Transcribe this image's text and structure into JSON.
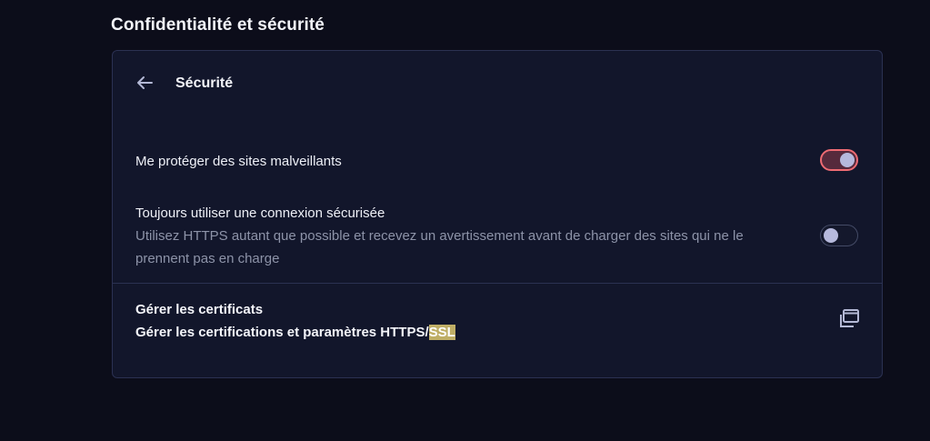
{
  "page": {
    "section_title": "Confidentialité et sécurité"
  },
  "card": {
    "header_title": "Sécurité",
    "back_icon": "arrow-left-icon"
  },
  "settings": [
    {
      "label": "Me protéger des sites malveillants",
      "description": "",
      "enabled": true
    },
    {
      "label": "Toujours utiliser une connexion sécurisée",
      "description": "Utilisez HTTPS autant que possible et recevez un avertissement avant de charger des sites qui ne le prennent pas en charge",
      "enabled": false
    }
  ],
  "certificates": {
    "title": "Gérer les certificats",
    "description_prefix": "Gérer les certifications et paramètres HTTPS/",
    "description_highlight": "SSL",
    "icon": "open-external-window-icon"
  },
  "colors": {
    "background": "#0c0d1a",
    "card": "#12162b",
    "toggle_on_border": "#ee6b73",
    "highlight": "#bfae66"
  }
}
